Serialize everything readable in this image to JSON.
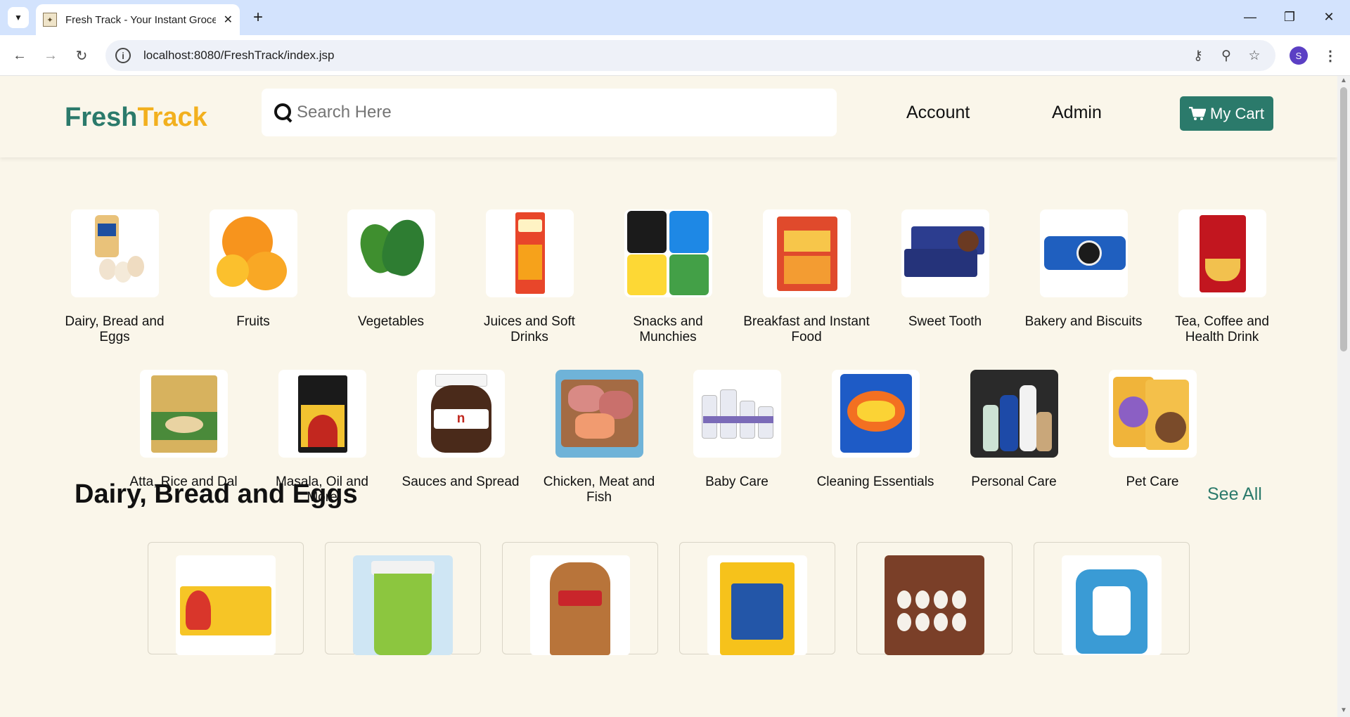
{
  "browser": {
    "tab_title": "Fresh Track - Your Instant Groce",
    "url": "localhost:8080/FreshTrack/index.jsp",
    "profile_initial": "S"
  },
  "header": {
    "logo_part1": "Fresh",
    "logo_part2": "Track",
    "search_placeholder": "Search Here",
    "nav": {
      "account": "Account",
      "admin": "Admin"
    },
    "cart_label": "My Cart"
  },
  "categories": [
    {
      "label": "Dairy, Bread and Eggs",
      "icon": "dairy-image"
    },
    {
      "label": "Fruits",
      "icon": "fruits-image"
    },
    {
      "label": "Vegetables",
      "icon": "vegetables-image"
    },
    {
      "label": "Juices and Soft Drinks",
      "icon": "juice-image"
    },
    {
      "label": "Snacks and Munchies",
      "icon": "snacks-image"
    },
    {
      "label": "Breakfast and Instant Food",
      "icon": "breakfast-image"
    },
    {
      "label": "Sweet Tooth",
      "icon": "sweet-image"
    },
    {
      "label": "Bakery and Biscuits",
      "icon": "biscuits-image"
    },
    {
      "label": "Tea, Coffee and Health Drink",
      "icon": "tea-image"
    },
    {
      "label": "Atta, Rice and Dal",
      "icon": "atta-image"
    },
    {
      "label": "Masala, Oil and More",
      "icon": "masala-image"
    },
    {
      "label": "Sauces and Spread",
      "icon": "sauces-image"
    },
    {
      "label": "Chicken, Meat and Fish",
      "icon": "meat-image"
    },
    {
      "label": "Baby Care",
      "icon": "babycare-image"
    },
    {
      "label": "Cleaning Essentials",
      "icon": "cleaning-image"
    },
    {
      "label": "Personal Care",
      "icon": "personalcare-image"
    },
    {
      "label": "Pet Care",
      "icon": "petcare-image"
    }
  ],
  "section": {
    "title": "Dairy, Bread and Eggs",
    "see_all": "See All"
  },
  "products": [
    {
      "icon": "butter-image"
    },
    {
      "icon": "masti-image"
    },
    {
      "icon": "bread-image"
    },
    {
      "icon": "cheese-image"
    },
    {
      "icon": "eggs-image"
    },
    {
      "icon": "milk-image"
    }
  ]
}
